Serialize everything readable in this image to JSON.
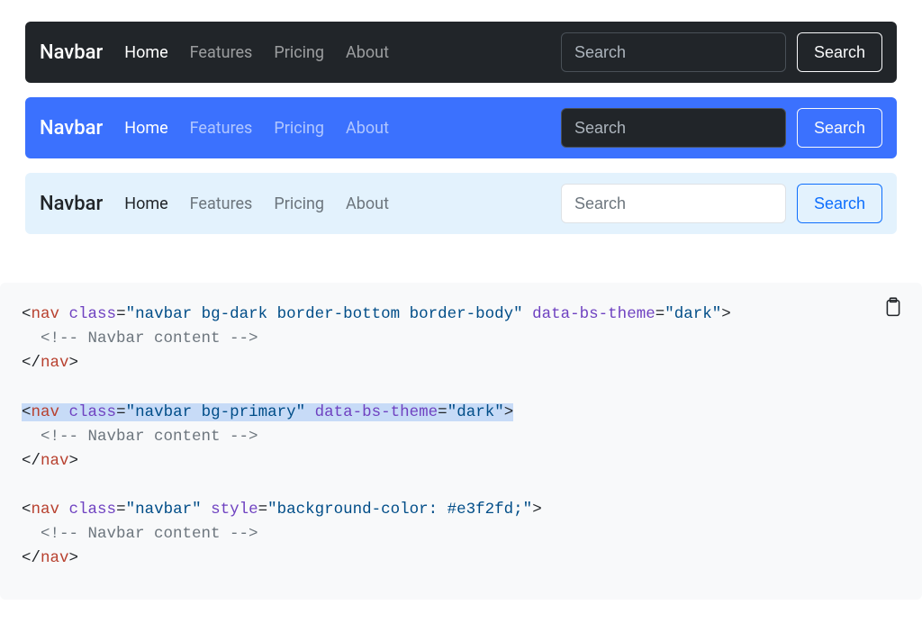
{
  "navbars": [
    {
      "variant": "dark",
      "brand": "Navbar",
      "links": [
        "Home",
        "Features",
        "Pricing",
        "About"
      ],
      "active_index": 0,
      "search_placeholder": "Search",
      "search_button": "Search"
    },
    {
      "variant": "primary",
      "brand": "Navbar",
      "links": [
        "Home",
        "Features",
        "Pricing",
        "About"
      ],
      "active_index": 0,
      "search_placeholder": "Search",
      "search_button": "Search"
    },
    {
      "variant": "light",
      "brand": "Navbar",
      "links": [
        "Home",
        "Features",
        "Pricing",
        "About"
      ],
      "active_index": 0,
      "search_placeholder": "Search",
      "search_button": "Search"
    }
  ],
  "code": {
    "blocks": [
      {
        "highlighted": false,
        "tag": "nav",
        "class_val": "navbar bg-dark border-bottom border-body",
        "theme_attr": "data-bs-theme",
        "theme_val": "dark",
        "style_attr": null,
        "style_val": null,
        "comment": "Navbar content"
      },
      {
        "highlighted": true,
        "tag": "nav",
        "class_val": "navbar bg-primary",
        "theme_attr": "data-bs-theme",
        "theme_val": "dark",
        "style_attr": null,
        "style_val": null,
        "comment": "Navbar content"
      },
      {
        "highlighted": false,
        "tag": "nav",
        "class_val": "navbar",
        "theme_attr": null,
        "theme_val": null,
        "style_attr": "style",
        "style_val": "background-color: #e3f2fd;",
        "comment": "Navbar content"
      }
    ]
  },
  "tokens": {
    "lt": "<",
    "gt": ">",
    "lt_slash": "</",
    "eq": "=",
    "q": "\"",
    "class": "class",
    "comment_open": "<!-- ",
    "comment_close": " -->"
  }
}
